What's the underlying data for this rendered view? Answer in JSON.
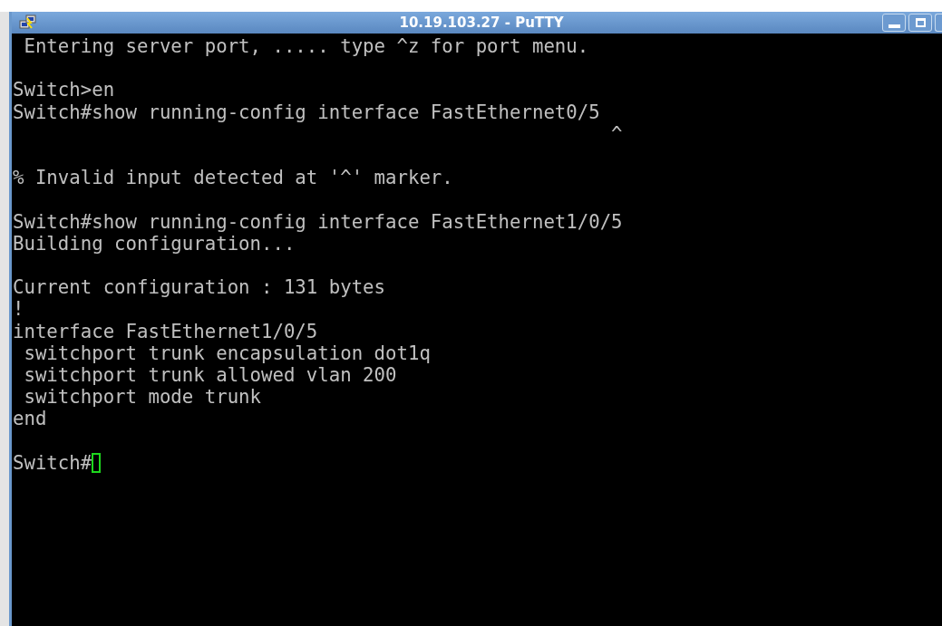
{
  "window": {
    "title": "10.19.103.27 - PuTTY"
  },
  "terminal": {
    "blocks": [
      [
        " Entering server port, ..... type ^z for port menu."
      ],
      [
        "Switch>en",
        "Switch#show running-config interface FastEthernet0/5",
        "                                                     ^"
      ],
      [
        "% Invalid input detected at '^' marker."
      ],
      [
        "Switch#show running-config interface FastEthernet1/0/5",
        "Building configuration..."
      ],
      [
        "Current configuration : 131 bytes",
        "!",
        "interface FastEthernet1/0/5",
        " switchport trunk encapsulation dot1q",
        " switchport trunk allowed vlan 200",
        " switchport mode trunk",
        "end"
      ]
    ],
    "prompt": {
      "text": "Switch#",
      "cursor": true
    }
  }
}
